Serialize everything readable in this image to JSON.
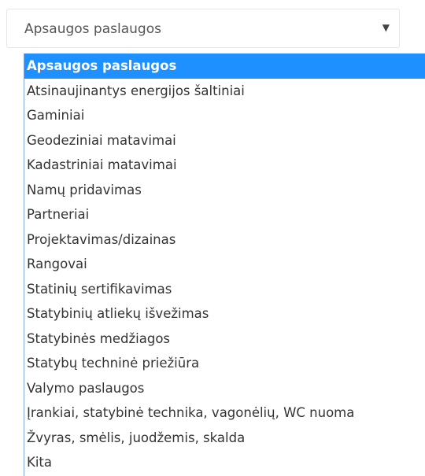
{
  "select": {
    "value": "Apsaugos paslaugos",
    "arrow_icon": "▼"
  },
  "dropdown": {
    "selected_index": 0,
    "options": [
      "Apsaugos paslaugos",
      "Atsinaujinantys energijos šaltiniai",
      "Gaminiai",
      "Geodeziniai matavimai",
      "Kadastriniai matavimai",
      "Namų pridavimas",
      "Partneriai",
      "Projektavimas/dizainas",
      "Rangovai",
      "Statinių sertifikavimas",
      "Statybinių atliekų išvežimas",
      "Statybinės medžiagos",
      "Statybų techninė priežiūra",
      "Valymo paslaugos",
      "Įrankiai, statybinė technika, vagonėlių, WC nuoma",
      "Žvyras, smėlis, juodžemis, skalda",
      "Kita"
    ]
  },
  "colors": {
    "highlight": "#1e90ff",
    "list_border": "#7ea7dd"
  }
}
